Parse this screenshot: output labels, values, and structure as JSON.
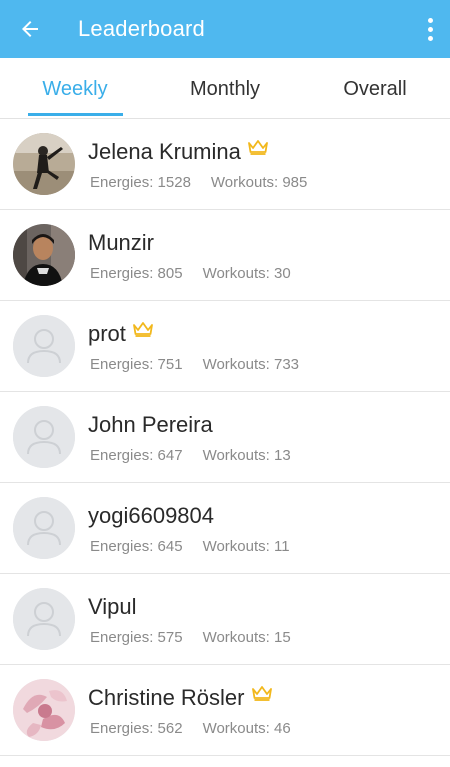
{
  "header": {
    "title": "Leaderboard",
    "back_icon": "arrow-left-icon",
    "menu_icon": "more-vert-icon",
    "color": "#4fb8ef"
  },
  "tabs": [
    {
      "label": "Weekly",
      "active": true
    },
    {
      "label": "Monthly",
      "active": false
    },
    {
      "label": "Overall",
      "active": false
    }
  ],
  "accent_color": "#3aaee9",
  "labels": {
    "energies": "Energies: ",
    "workouts": "Workouts: "
  },
  "leaderboard": [
    {
      "name": "Jelena Krumina",
      "energies": "1528",
      "workouts": "985",
      "crown": true,
      "avatar": "photo-person-exercising"
    },
    {
      "name": "Munzir",
      "energies": "805",
      "workouts": "30",
      "crown": false,
      "avatar": "photo-person-portrait"
    },
    {
      "name": "prot",
      "energies": "751",
      "workouts": "733",
      "crown": true,
      "avatar": "default-avatar-icon"
    },
    {
      "name": "John Pereira",
      "energies": "647",
      "workouts": "13",
      "crown": false,
      "avatar": "default-avatar-icon"
    },
    {
      "name": "yogi6609804",
      "energies": "645",
      "workouts": "11",
      "crown": false,
      "avatar": "default-avatar-icon"
    },
    {
      "name": "Vipul",
      "energies": "575",
      "workouts": "15",
      "crown": false,
      "avatar": "default-avatar-icon"
    },
    {
      "name": "Christine Rösler",
      "energies": "562",
      "workouts": "46",
      "crown": true,
      "avatar": "photo-pink-flower"
    }
  ]
}
